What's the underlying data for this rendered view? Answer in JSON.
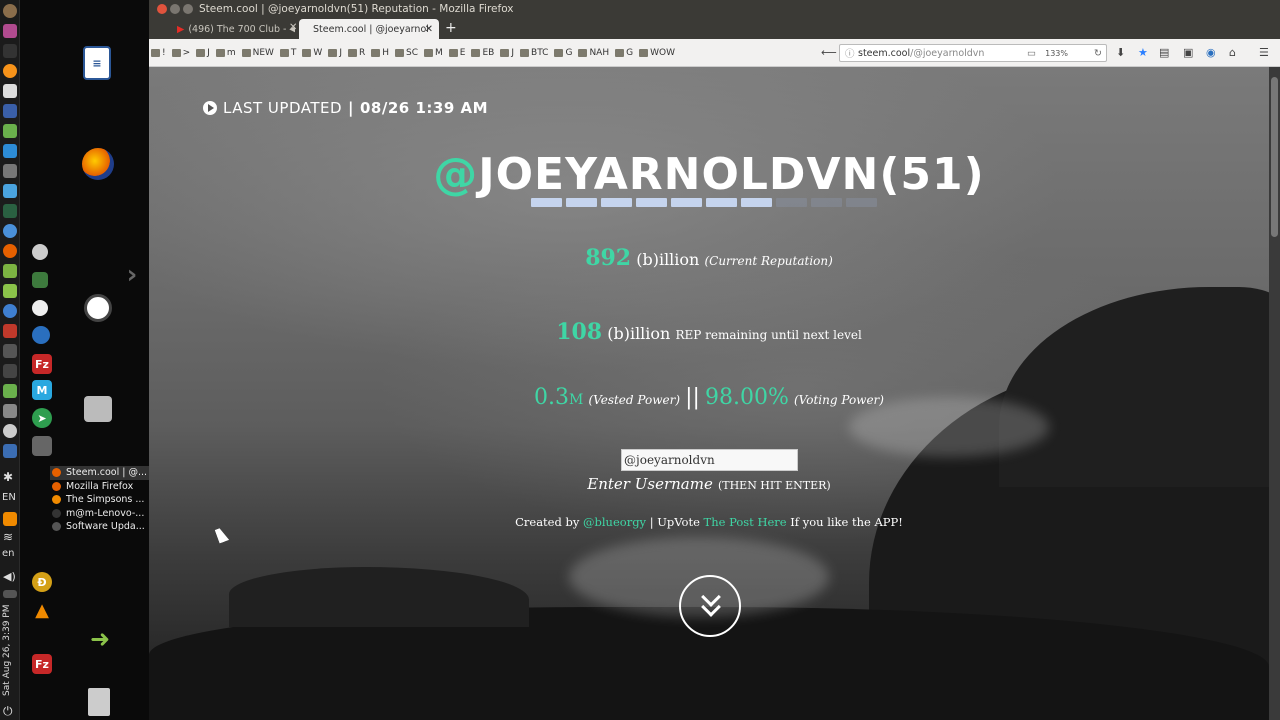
{
  "system": {
    "clock": "Sat Aug 26, 3:39 PM",
    "lang": "en",
    "kbd": "EN"
  },
  "dock": {
    "windows": [
      {
        "label": "Steem.cool | @...",
        "color": "#e66000",
        "active": true
      },
      {
        "label": "Mozilla Firefox",
        "color": "#e66000",
        "active": false
      },
      {
        "label": "The Simpsons ...",
        "color": "#f08a00",
        "active": false
      },
      {
        "label": "m@m-Lenovo-...",
        "color": "#333333",
        "active": false
      },
      {
        "label": "Software Upda...",
        "color": "#555555",
        "active": false
      }
    ]
  },
  "browser": {
    "window_title": "Steem.cool | @joeyarnoldvn(51) Reputation - Mozilla Firefox",
    "tabs": [
      {
        "label": "(496) The 700 Club -"
      },
      {
        "label": "Steem.cool | @joeyarnol"
      }
    ],
    "url_host": "steem.cool",
    "url_path": "/@joeyarnoldvn",
    "zoom": "133%",
    "bookmarks": [
      "!",
      ">",
      "J",
      "m",
      "NEW",
      "T",
      "W",
      "J",
      "R",
      "H",
      "SC",
      "M",
      "E",
      "EB",
      "J",
      "BTC",
      "G",
      "NAH",
      "G",
      "WOW"
    ]
  },
  "page": {
    "last_updated_label": "LAST UPDATED",
    "last_updated_value": "08/26 1:39 AM",
    "username_at": "@",
    "username": "JOEYARNOLDVN(51)",
    "reputation_progress": 0.7,
    "current_rep_value": "892",
    "current_rep_unit": "(b)illion",
    "current_rep_note": "(Current Reputation)",
    "remaining_value": "108",
    "remaining_unit": "(b)illion",
    "remaining_note": "REP remaining until next level",
    "vested_value": "0.3",
    "vested_unit": "M",
    "vested_note": "(Vested Power)",
    "separator": "||",
    "voting_value": "98.00%",
    "voting_note": "(Voting Power)",
    "input_value": "@joeyarnoldvn",
    "enter_hint": "Enter Username",
    "enter_hint_sub": "(THEN HIT ENTER)",
    "credits_created_by": "Created by",
    "credits_author": "@blueorgy",
    "credits_upvote": "| UpVote",
    "credits_post": "The Post Here",
    "credits_tail": "If you like the APP!"
  },
  "colors": {
    "accent": "#3fd6a5",
    "rep_filled": "#c5d4ee",
    "rep_empty": "#8a93a3"
  }
}
